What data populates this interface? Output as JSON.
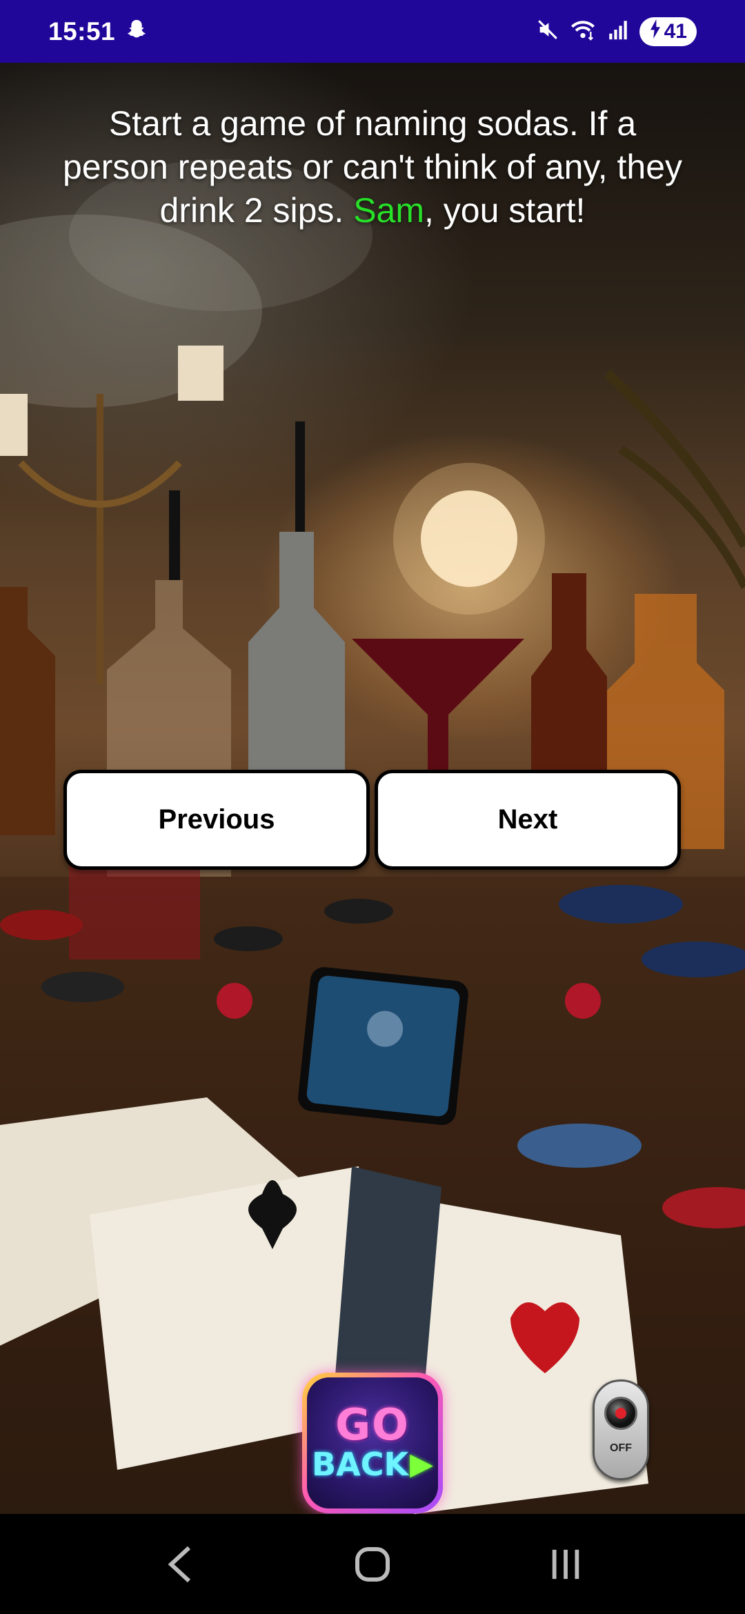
{
  "status_bar": {
    "time": "15:51",
    "battery_level": "41",
    "icons": [
      "snapchat-icon",
      "mute-icon",
      "wifi-icon",
      "signal-icon",
      "battery-charging-icon"
    ]
  },
  "instruction": {
    "text_before": "Start a game of naming sodas. If a person repeats or can't think of any, they drink 2 sips. ",
    "player": "Sam",
    "text_after": ", you start!",
    "player_color": "#27e028"
  },
  "buttons": {
    "previous_label": "Previous",
    "next_label": "Next"
  },
  "go_back": {
    "line1": "GO",
    "line2": "BACK"
  },
  "toggle": {
    "label": "OFF"
  },
  "system_nav": {
    "icons": [
      "back-icon",
      "home-icon",
      "recents-icon"
    ]
  },
  "colors": {
    "status_bar_bg": "#21069a",
    "accent_green": "#27e028"
  }
}
